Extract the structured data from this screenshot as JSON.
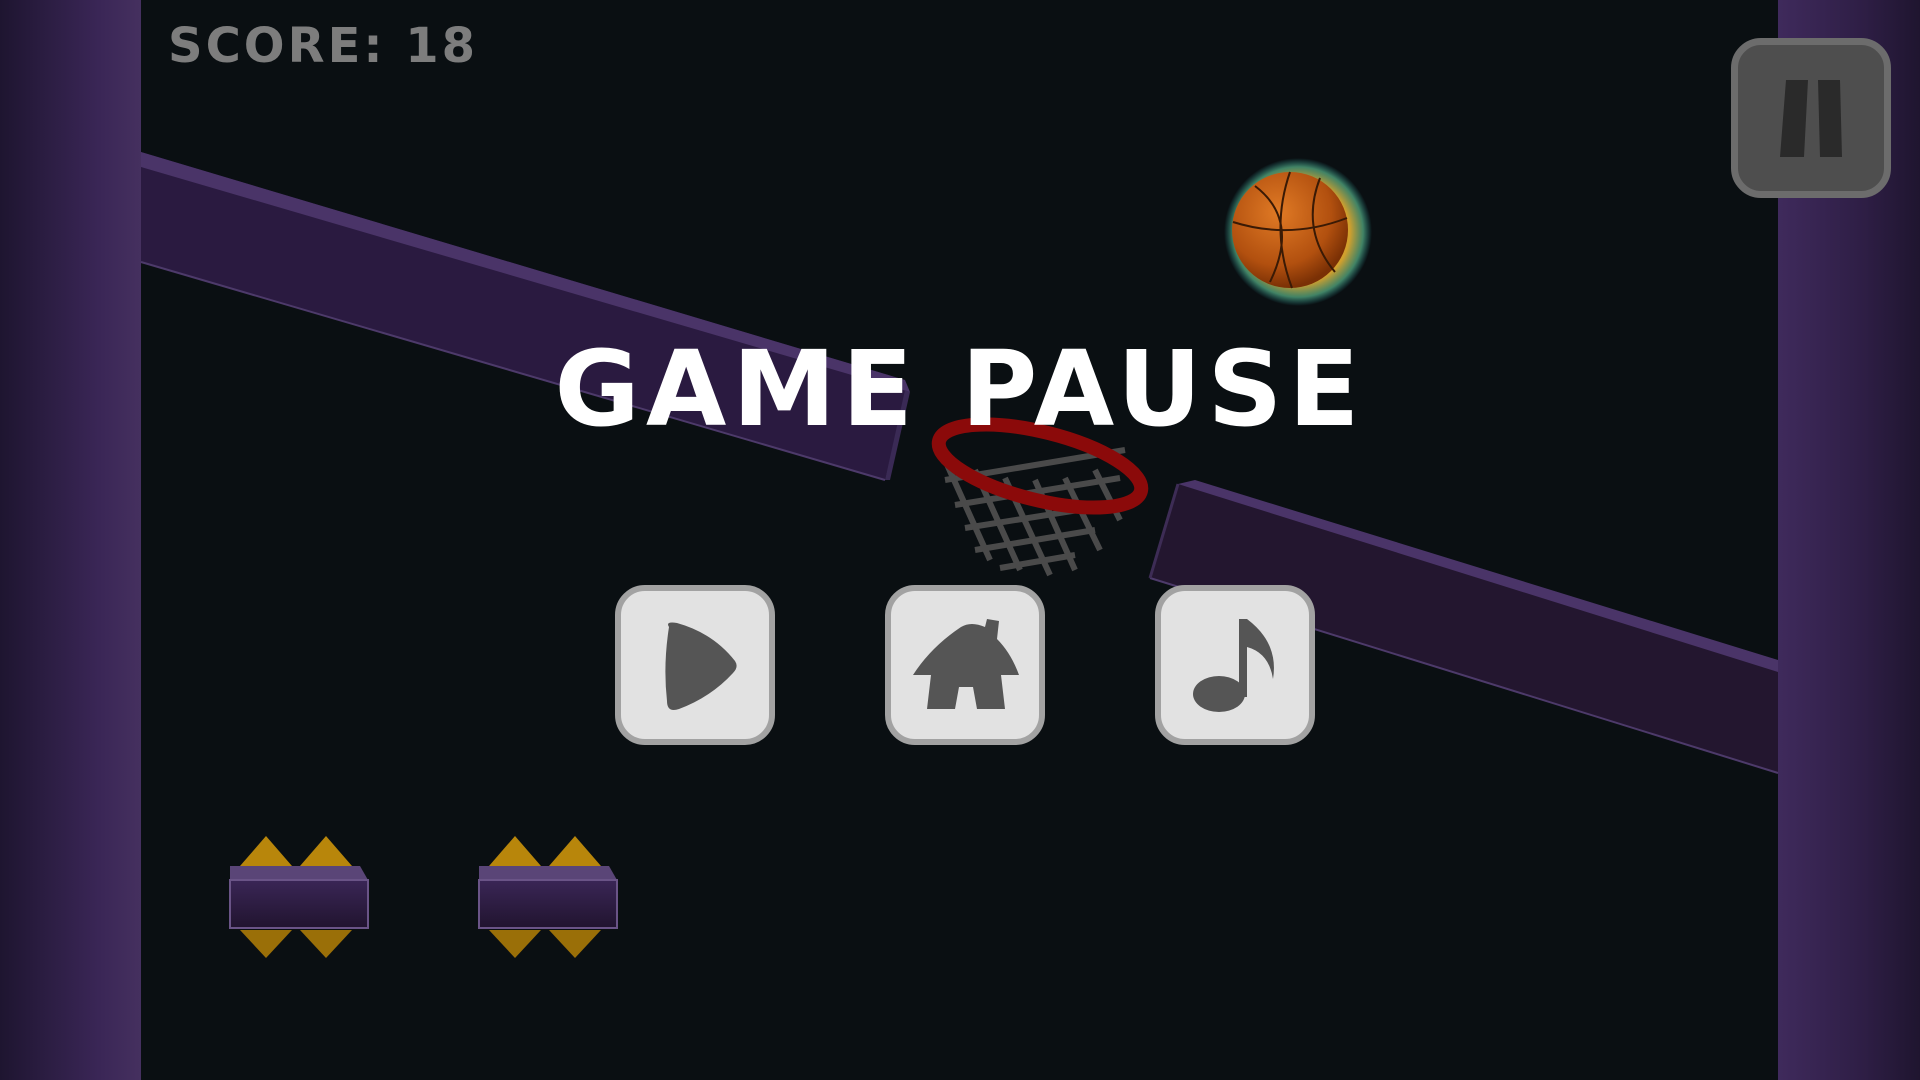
{
  "hud": {
    "score_text": "SCORE: 18"
  },
  "pause_overlay": {
    "title": "GAME PAUSE",
    "buttons": [
      {
        "id": "resume",
        "icon": "play-icon"
      },
      {
        "id": "home",
        "icon": "home-icon"
      },
      {
        "id": "music",
        "icon": "music-note-icon"
      }
    ]
  },
  "colors": {
    "background": "#0a0f12",
    "wall_purple": "#3a2656",
    "ramp_purple": "#2a1a40",
    "hoop_red": "#8b0a0a",
    "score_gray": "#7d7d7d",
    "title_white": "#ffffff",
    "button_face": "#e2e2e2",
    "button_icon": "#555555",
    "spike_gold": "#b8860b"
  }
}
